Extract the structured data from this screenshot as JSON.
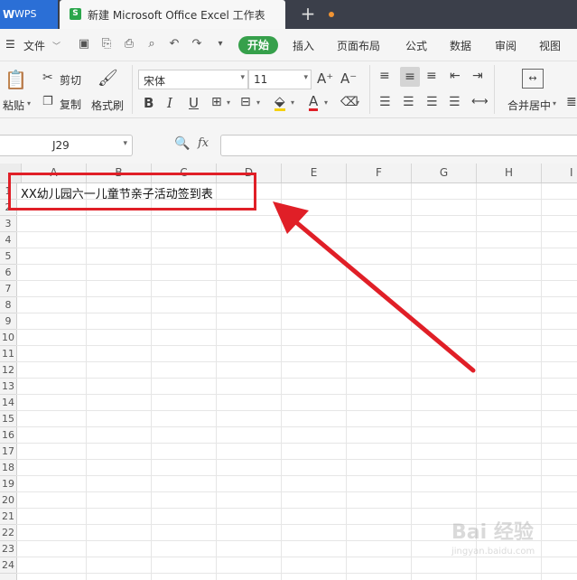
{
  "titlebar": {
    "app_tab": "WPS",
    "doc_tab": "新建 Microsoft Office Excel 工作表",
    "new_tab": "+"
  },
  "menu": {
    "file": "文件",
    "items": [
      "开始",
      "插入",
      "页面布局",
      "公式",
      "数据",
      "审阅",
      "视图"
    ]
  },
  "ribbon": {
    "paste": "粘贴",
    "cut": "剪切",
    "copy": "复制",
    "format_painter": "格式刷",
    "font_name": "宋体",
    "font_size": "11",
    "bold": "B",
    "italic": "I",
    "underline": "U",
    "font_color_glyph": "A",
    "merge_center": "合并居中"
  },
  "formula_bar": {
    "name_box": "J29",
    "fx": "fx",
    "value": ""
  },
  "grid": {
    "columns": [
      "A",
      "B",
      "C",
      "D",
      "E",
      "F",
      "G",
      "H",
      "I"
    ],
    "rows": [
      "1",
      "2",
      "3",
      "4",
      "5",
      "6",
      "7",
      "8",
      "9",
      "10",
      "11",
      "12",
      "13",
      "14",
      "15",
      "16",
      "17",
      "18",
      "19",
      "20",
      "21",
      "22",
      "23",
      "24"
    ],
    "cell_a1": "XX幼儿园六一儿童节亲子活动签到表"
  },
  "annotation": {
    "box_color": "#e01f27",
    "arrow_color": "#e01f27"
  },
  "watermark": {
    "main": "Bai 经验",
    "sub": "jingyan.baidu.com"
  },
  "colors": {
    "title_bg": "#3b3f4a",
    "wps_tab": "#2b6fd6",
    "start_tab": "#36a04b",
    "modified_dot": "#f19433"
  }
}
